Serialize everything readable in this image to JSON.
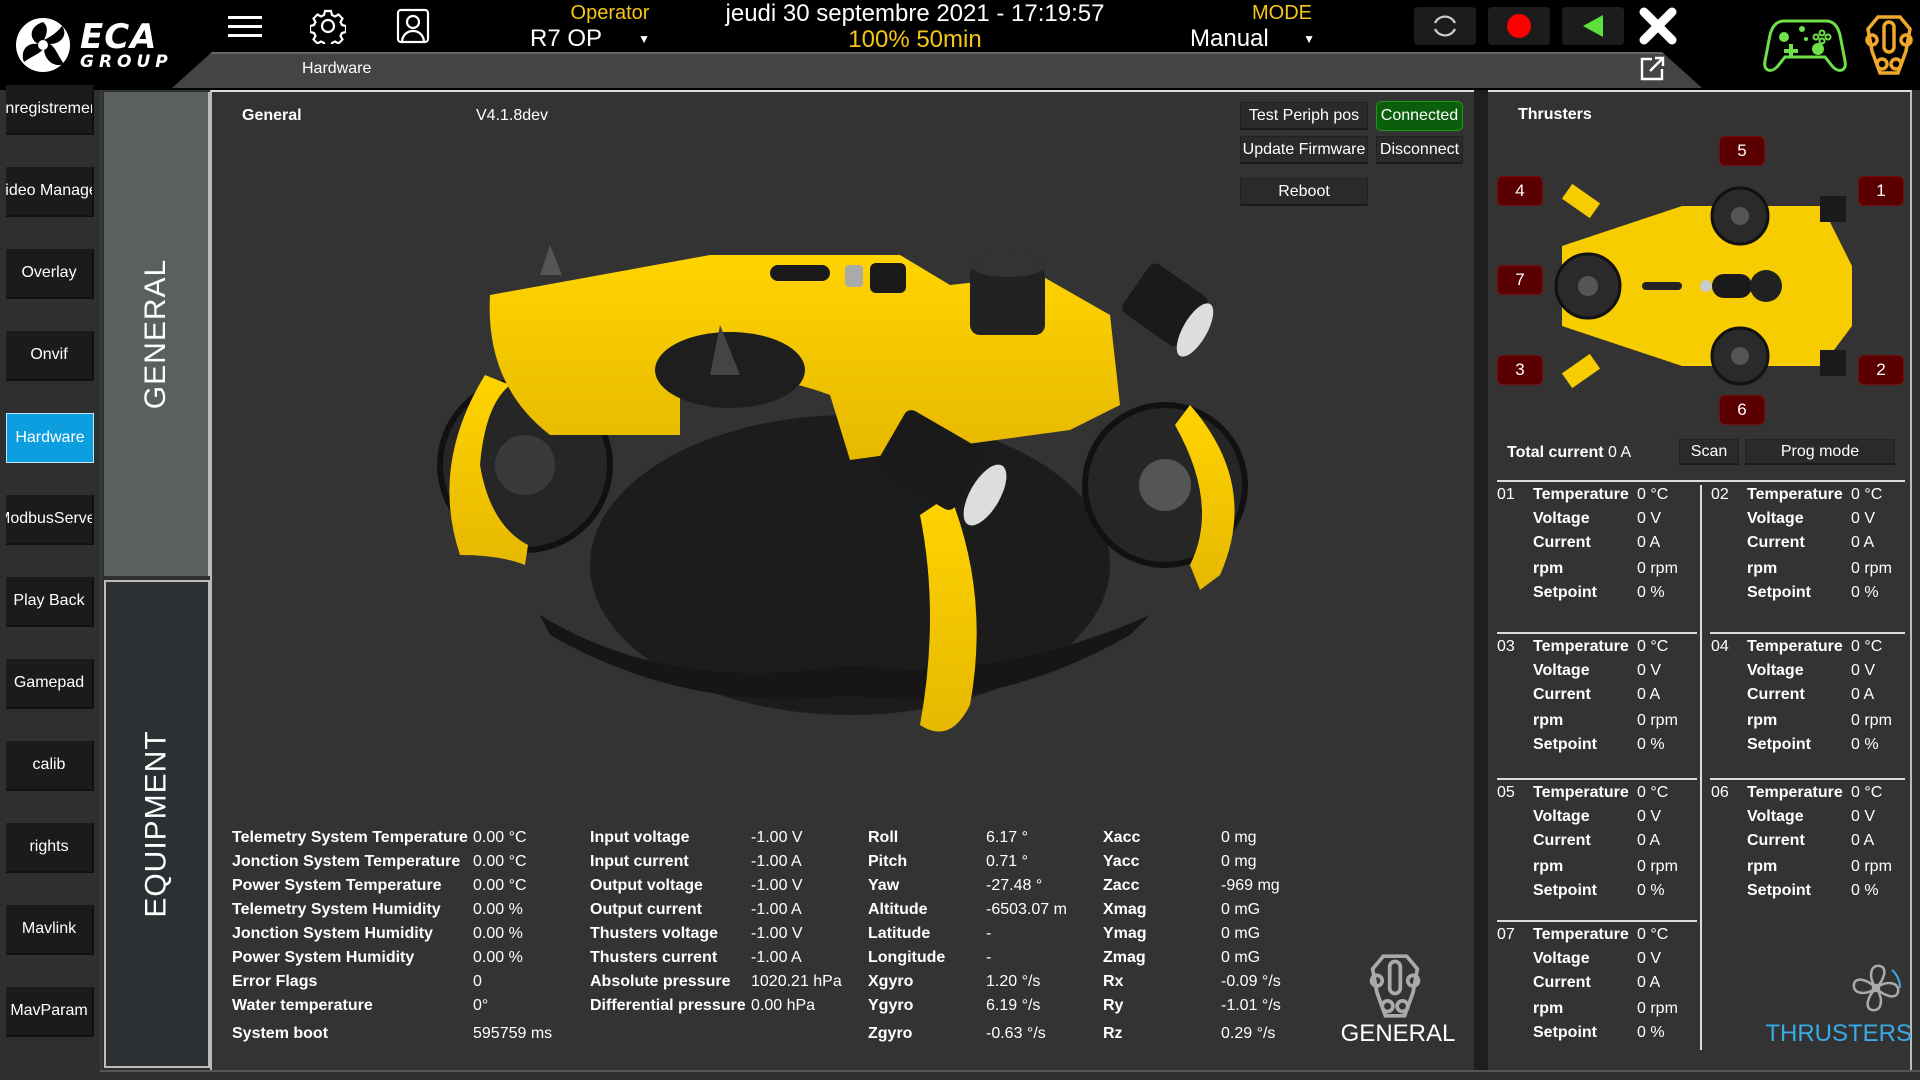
{
  "header": {
    "brand_top": "ECA",
    "brand_bottom": "GROUP",
    "operator_label": "Operator",
    "operator_value": "R7 OP",
    "datetime": "jeudi 30 septembre 2021 - 17:19:57",
    "battery": "100% 50min",
    "mode_label": "MODE",
    "mode_value": "Manual",
    "page_title": "Hardware",
    "icons": [
      "menu-icon",
      "gear-icon",
      "user-icon",
      "refresh-icon",
      "record-icon",
      "play-back-icon",
      "close-icon",
      "popout-icon",
      "gamepad-icon",
      "rov-icon"
    ],
    "colors": {
      "accent_yellow": "#f5c518",
      "record_red": "#ff0000",
      "play_green": "#5de03c",
      "gamepad_green": "#6ee04a",
      "rov_orange": "#f0a82a",
      "active_blue": "#0d9ee0"
    }
  },
  "sidebar": {
    "items": [
      {
        "label": "Enregistrement",
        "active": false
      },
      {
        "label": "Video Manager",
        "active": false
      },
      {
        "label": "Overlay",
        "active": false
      },
      {
        "label": "Onvif",
        "active": false
      },
      {
        "label": "Hardware",
        "active": true
      },
      {
        "label": "ModbusServer",
        "active": false
      },
      {
        "label": "Play Back",
        "active": false
      },
      {
        "label": "Gamepad",
        "active": false
      },
      {
        "label": "calib",
        "active": false
      },
      {
        "label": "rights",
        "active": false
      },
      {
        "label": "Mavlink",
        "active": false
      },
      {
        "label": "MavParam",
        "active": false
      }
    ]
  },
  "vtabs": {
    "general": "GENERAL",
    "equipment": "EQUIPMENT"
  },
  "general": {
    "title": "General",
    "version": "V4.1.8dev",
    "buttons": {
      "test_periph": "Test Periph pos",
      "connected": "Connected",
      "update_firmware": "Update Firmware",
      "disconnect": "Disconnect",
      "reboot": "Reboot"
    },
    "col1": [
      {
        "k": "Telemetry System Temperature",
        "v": "0.00 °C"
      },
      {
        "k": "Jonction System Temperature",
        "v": "0.00 °C"
      },
      {
        "k": "Power System Temperature",
        "v": "0.00 °C"
      },
      {
        "k": "Telemetry System Humidity",
        "v": "0.00 %"
      },
      {
        "k": "Jonction System Humidity",
        "v": "0.00 %"
      },
      {
        "k": "Power System Humidity",
        "v": "0.00 %"
      },
      {
        "k": "Error Flags",
        "v": "0"
      },
      {
        "k": "Water temperature",
        "v": "0°"
      },
      {
        "k": "System boot",
        "v": "595759 ms"
      }
    ],
    "col2": [
      {
        "k": "Input voltage",
        "v": "-1.00 V"
      },
      {
        "k": "Input current",
        "v": "-1.00 A"
      },
      {
        "k": "Output voltage",
        "v": "-1.00 V"
      },
      {
        "k": "Output current",
        "v": "-1.00 A"
      },
      {
        "k": "Thusters voltage",
        "v": "-1.00 V"
      },
      {
        "k": "Thusters current",
        "v": "-1.00 A"
      },
      {
        "k": "Absolute pressure",
        "v": "1020.21 hPa"
      },
      {
        "k": "Differential pressure",
        "v": "0.00 hPa"
      }
    ],
    "col3": [
      {
        "k": "Roll",
        "v": "6.17 °"
      },
      {
        "k": "Pitch",
        "v": "0.71 °"
      },
      {
        "k": "Yaw",
        "v": "-27.48 °"
      },
      {
        "k": "Altitude",
        "v": "-6503.07 m"
      },
      {
        "k": "Latitude",
        "v": "-"
      },
      {
        "k": "Longitude",
        "v": "-"
      },
      {
        "k": "Xgyro",
        "v": "1.20 °/s"
      },
      {
        "k": "Ygyro",
        "v": "6.19 °/s"
      },
      {
        "k": "Zgyro",
        "v": "-0.63 °/s"
      }
    ],
    "col4": [
      {
        "k": "Xacc",
        "v": "0 mg"
      },
      {
        "k": "Yacc",
        "v": "0 mg"
      },
      {
        "k": "Zacc",
        "v": "-969 mg"
      },
      {
        "k": "Xmag",
        "v": "0 mG"
      },
      {
        "k": "Ymag",
        "v": "0 mG"
      },
      {
        "k": "Zmag",
        "v": "0 mG"
      },
      {
        "k": "Rx",
        "v": "-0.09 °/s"
      },
      {
        "k": "Ry",
        "v": "-1.01 °/s"
      },
      {
        "k": "Rz",
        "v": "0.29 °/s"
      }
    ],
    "footer_label": "GENERAL"
  },
  "thrusters": {
    "title": "Thrusters",
    "badges": [
      "1",
      "2",
      "3",
      "4",
      "5",
      "6",
      "7"
    ],
    "total_current_label": "Total current",
    "total_current_value": "0 A",
    "scan_label": "Scan",
    "prog_mode_label": "Prog mode",
    "field_labels": {
      "temperature": "Temperature",
      "voltage": "Voltage",
      "current": "Current",
      "rpm": "rpm",
      "setpoint": "Setpoint"
    },
    "units": [
      {
        "id": "01",
        "temperature": "0 °C",
        "voltage": "0 V",
        "current": "0 A",
        "rpm": "0 rpm",
        "setpoint": "0 %"
      },
      {
        "id": "02",
        "temperature": "0 °C",
        "voltage": "0 V",
        "current": "0 A",
        "rpm": "0 rpm",
        "setpoint": "0 %"
      },
      {
        "id": "03",
        "temperature": "0 °C",
        "voltage": "0 V",
        "current": "0 A",
        "rpm": "0 rpm",
        "setpoint": "0 %"
      },
      {
        "id": "04",
        "temperature": "0 °C",
        "voltage": "0 V",
        "current": "0 A",
        "rpm": "0 rpm",
        "setpoint": "0 %"
      },
      {
        "id": "05",
        "temperature": "0 °C",
        "voltage": "0 V",
        "current": "0 A",
        "rpm": "0 rpm",
        "setpoint": "0 %"
      },
      {
        "id": "06",
        "temperature": "0 °C",
        "voltage": "0 V",
        "current": "0 A",
        "rpm": "0 rpm",
        "setpoint": "0 %"
      },
      {
        "id": "07",
        "temperature": "0 °C",
        "voltage": "0 V",
        "current": "0 A",
        "rpm": "0 rpm",
        "setpoint": "0 %"
      }
    ],
    "footer_label": "THRUSTERS"
  }
}
